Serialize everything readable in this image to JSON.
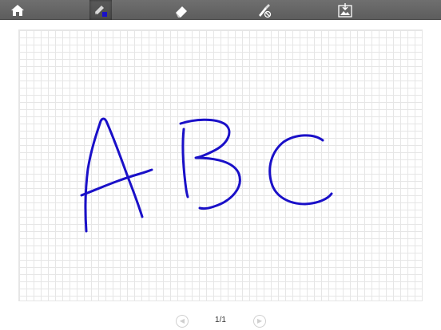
{
  "toolbar": {
    "tools": [
      {
        "icon": "home-icon"
      },
      {
        "icon": "pen-icon",
        "active": true
      },
      {
        "icon": "eraser-icon"
      },
      {
        "icon": "clear-brush-icon"
      },
      {
        "icon": "export-image-icon"
      }
    ],
    "background_color": "#666666"
  },
  "canvas": {
    "grid": true,
    "ink_color": "#1a10c8"
  },
  "pager": {
    "page_indicator": "1/1",
    "prev_icon": "prev-page-icon",
    "next_icon": "next-page-icon"
  }
}
